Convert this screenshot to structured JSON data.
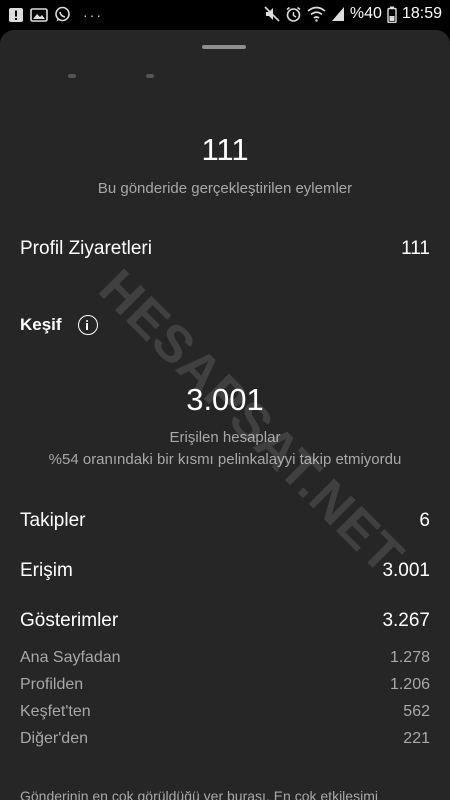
{
  "status_bar": {
    "battery_text": "%40",
    "time": "18:59",
    "left_icons": [
      "alert-icon",
      "image-icon",
      "whatsapp-icon",
      "more-icon"
    ],
    "right_icons": [
      "mute-icon",
      "alarm-icon",
      "wifi-icon",
      "signal-icon",
      "battery-icon"
    ]
  },
  "summary": {
    "total_actions": "111",
    "total_actions_label": "Bu gönderide gerçekleştirilen eylemler"
  },
  "profile_visits": {
    "label": "Profil Ziyaretleri",
    "value": "111"
  },
  "discovery": {
    "title": "Keşif",
    "reach_value": "3.001",
    "reach_label": "Erişilen hesaplar",
    "reach_note": "%54 oranındaki bir kısmı pelinkalayyi takip etmiyordu"
  },
  "metrics": [
    {
      "label": "Takipler",
      "value": "6"
    },
    {
      "label": "Erişim",
      "value": "3.001"
    },
    {
      "label": "Gösterimler",
      "value": "3.267"
    }
  ],
  "impression_sources": [
    {
      "label": "Ana Sayfadan",
      "value": "1.278"
    },
    {
      "label": "Profilden",
      "value": "1.206"
    },
    {
      "label": "Keşfet'ten",
      "value": "562"
    },
    {
      "label": "Diğer'den",
      "value": "221"
    }
  ],
  "watermark": "HESAPSAT.NET",
  "footer_text": "Gönderinin en çok görüldüğü yer burası. En çok etkileşimi"
}
